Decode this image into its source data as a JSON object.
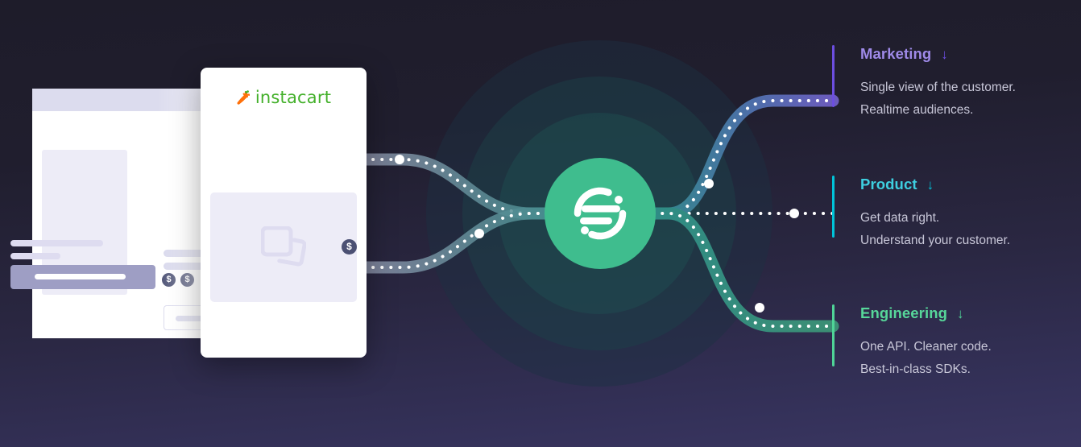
{
  "background": {
    "top_color": "#1e1c2a",
    "bottom_color": "#3a3661"
  },
  "brand_card": {
    "logo_name": "instacart-logo",
    "logo_text": "instacart",
    "logo_text_color": "#43b02a",
    "carrot_color": "#ff7009",
    "carrot_leaf_color": "#43b02a",
    "image_placeholder_name": "image-placeholder-icon",
    "badge_symbol": "$",
    "badge_color": "#4b5073"
  },
  "browser_mockup": {
    "name": "background-app-mockup",
    "header_color": "#dcdcee",
    "badge_symbol": "$",
    "badge_count": 2
  },
  "hub": {
    "name": "segment-logo",
    "circle_color": "#3fbd8e",
    "mark_color": "#ffffff"
  },
  "pipes": {
    "input_color": "#8b90a8",
    "marketing_color": "#6b5bbd",
    "product_color": "#1e9cab",
    "engineering_color": "#3c8e74"
  },
  "channels": [
    {
      "id": "marketing",
      "title": "Marketing",
      "title_color": "#9f8ae8",
      "bar_color": "#6c4ee0",
      "arrow": "↓",
      "lines": [
        "Single view of the customer.",
        "Realtime audiences."
      ]
    },
    {
      "id": "product",
      "title": "Product",
      "title_color": "#3ecfe0",
      "bar_color": "#00c4d9",
      "arrow": "↓",
      "lines": [
        "Get data right.",
        "Understand your customer."
      ]
    },
    {
      "id": "engineering",
      "title": "Engineering",
      "title_color": "#57d79a",
      "bar_color": "#4fd497",
      "arrow": "↓",
      "lines": [
        "One API. Cleaner code.",
        "Best-in-class SDKs."
      ]
    }
  ]
}
